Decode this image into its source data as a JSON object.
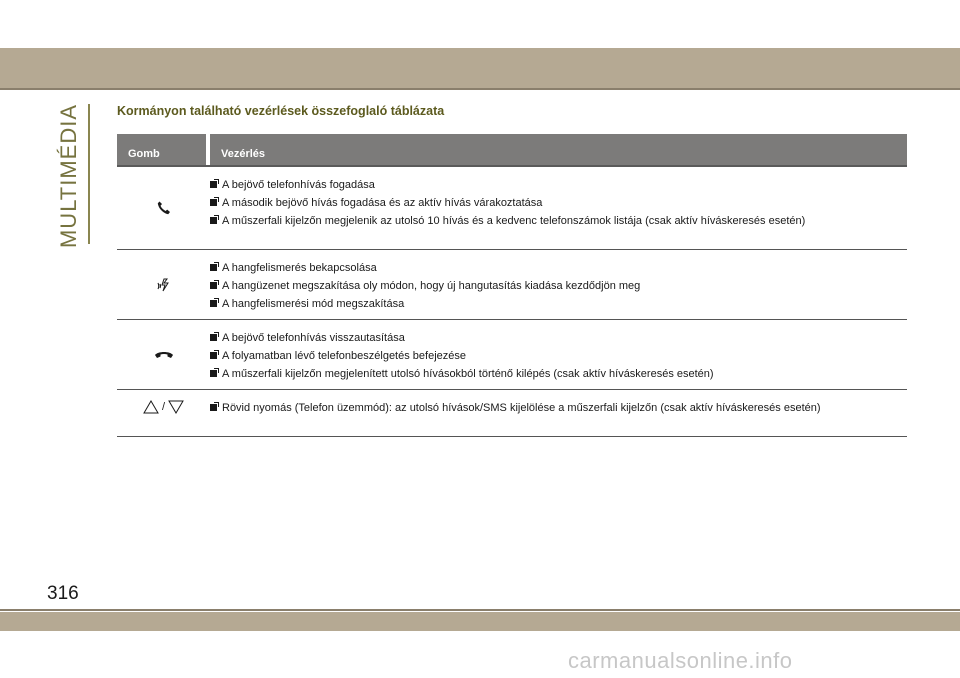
{
  "side_label": "MULTIMÉDIA",
  "page_number": "316",
  "section_title": "Kormányon található vezérlések összefoglaló táblázata",
  "table": {
    "headers": [
      "Gomb",
      "Vezérlés"
    ],
    "rows": [
      {
        "icon": "phone-accept-icon",
        "items": [
          "A bejövő telefonhívás fogadása",
          "A második bejövő hívás fogadása és az aktív hívás várakoztatása",
          "A műszerfali kijelzőn megjelenik az utolsó 10 hívás és a kedvenc telefonszámok listája (csak aktív híváskeresés esetén)"
        ]
      },
      {
        "icon": "voice-recognition-icon",
        "items": [
          "A hangfelismerés bekapcsolása",
          "A hangüzenet megszakítása oly módon, hogy új hangutasítás kiadása kezdődjön meg",
          "A hangfelismerési mód megszakítása"
        ]
      },
      {
        "icon": "phone-hangup-icon",
        "items": [
          "A bejövő telefonhívás visszautasítása",
          "A folyamatban lévő telefonbeszélgetés befejezése",
          "A műszerfali kijelzőn megjelenített utolsó hívásokból történő kilépés (csak aktív híváskeresés esetén)"
        ]
      },
      {
        "icon": "up-down-arrows-icon",
        "icon_separator": "/",
        "items": [
          "Rövid nyomás (Telefon üzemmód): az utolsó hívások/SMS kijelölése a műszerfali kijelzőn (csak aktív híváskeresés esetén)"
        ]
      }
    ]
  },
  "watermark": "carmanualsonline.info",
  "colors": {
    "band": "#b5a993",
    "accent_olive": "#76733f",
    "title_olive": "#5c5a1e",
    "header_gray": "#7c7b7a"
  }
}
